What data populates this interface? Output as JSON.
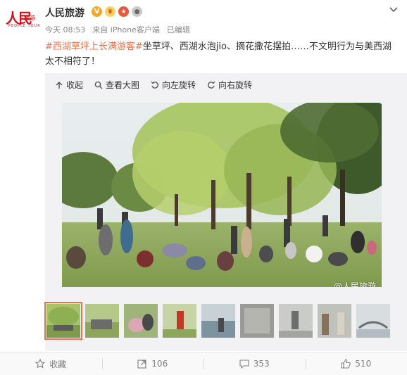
{
  "account": {
    "name": "人民旅游",
    "logo_text": "人民",
    "logo_sub": "旅游",
    "logo_en": "PEOPLE TOUR",
    "verified_badge": "V"
  },
  "meta": {
    "time": "今天 08:53",
    "source": "来自 iPhone客户端",
    "edited": "已编辑"
  },
  "post": {
    "topic": "#西湖草坪上长满游客#",
    "text": "坐草坪、西湖水泡jio、摘花撒花摆拍……不文明行为与美西湖太不相符了！"
  },
  "toolbar": {
    "collapse": "收起",
    "view_large": "查看大图",
    "rotate_left": "向左旋转",
    "rotate_right": "向右旋转"
  },
  "watermark": "@人民旅游",
  "thumbnails": [
    "thumb-1",
    "thumb-2",
    "thumb-3",
    "thumb-4",
    "thumb-5",
    "thumb-6",
    "thumb-7",
    "thumb-8",
    "thumb-9"
  ],
  "footer": {
    "favorite": "收藏",
    "repost": "106",
    "comment": "353",
    "like": "510"
  },
  "colors": {
    "topic": "#eb7350",
    "brand": "#d4121b",
    "badge": "#f6a623"
  }
}
